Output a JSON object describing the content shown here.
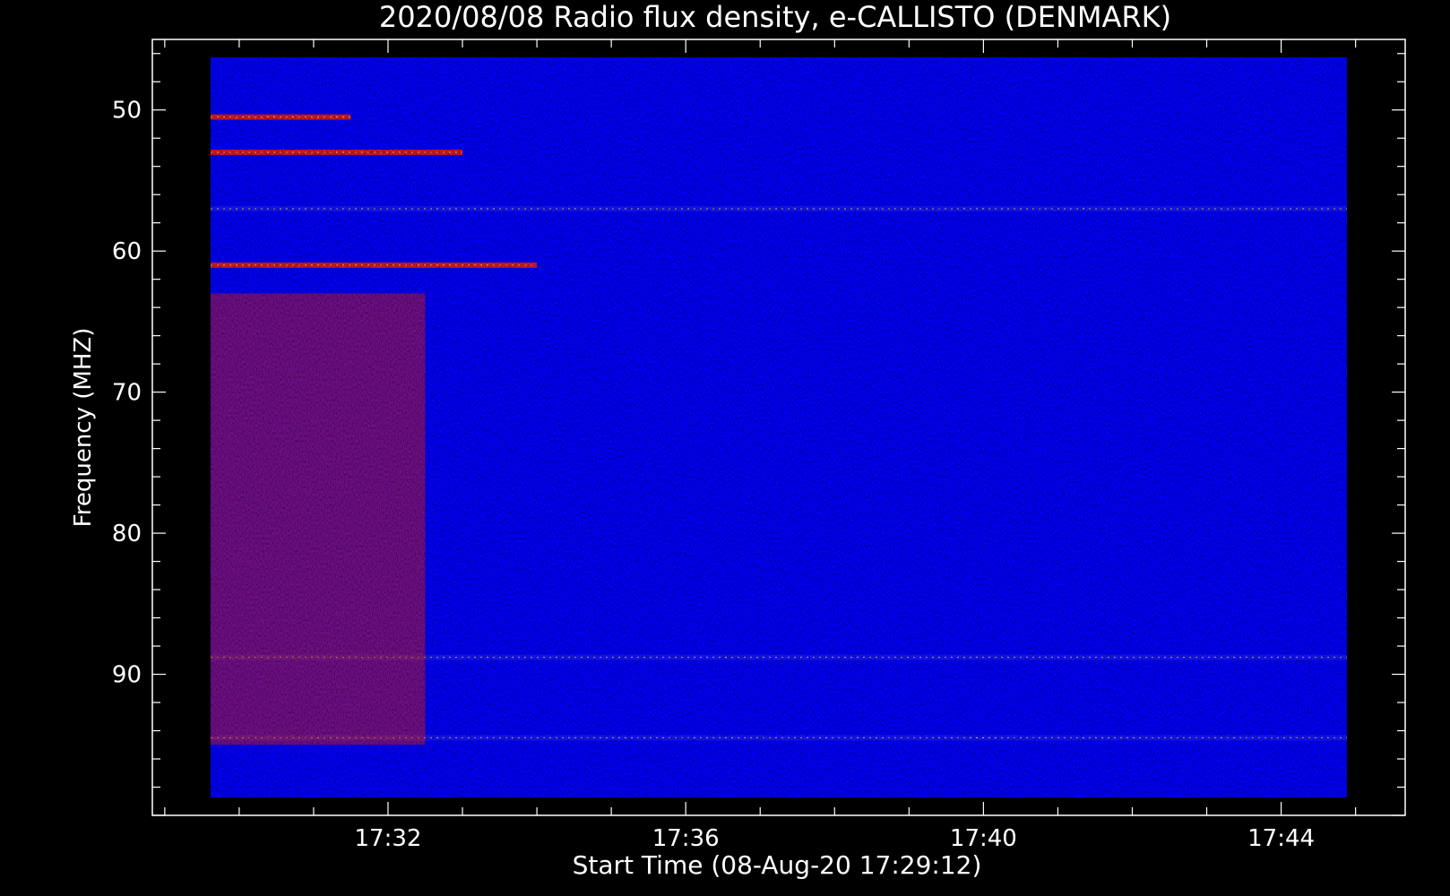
{
  "chart_data": {
    "type": "heatmap",
    "title": "2020/08/08  Radio flux density, e-CALLISTO (DENMARK)",
    "xlabel": "Start Time (08-Aug-20 17:29:12)",
    "ylabel": "Frequency (MHZ)",
    "x_range": [
      "17:28:50",
      "17:45:40"
    ],
    "xlim": [
      "17:28:50",
      "17:45:40"
    ],
    "ylim": [
      45,
      100
    ],
    "y_inverted": true,
    "x_ticks": [
      {
        "label": "17:32",
        "time": "17:32"
      },
      {
        "label": "17:36",
        "time": "17:36"
      },
      {
        "label": "17:40",
        "time": "17:40"
      },
      {
        "label": "17:44",
        "time": "17:44"
      }
    ],
    "y_ticks": [
      {
        "label": "50",
        "value": 50
      },
      {
        "label": "60",
        "value": 60
      },
      {
        "label": "70",
        "value": 70
      },
      {
        "label": "80",
        "value": 80
      },
      {
        "label": "90",
        "value": 90
      }
    ],
    "colormap": [
      "#000000",
      "#2020ff",
      "#ff2000",
      "#ffe060"
    ],
    "background_color": "#0000ff",
    "axes_color": "#ffffff",
    "features": [
      {
        "kind": "band",
        "freq": 50.5,
        "t_start": "17:29:12",
        "t_end": "17:31:30",
        "intensity": "high"
      },
      {
        "kind": "band",
        "freq": 53,
        "t_start": "17:29:12",
        "t_end": "17:33:00",
        "intensity": "high"
      },
      {
        "kind": "band",
        "freq": 57,
        "t_start": "17:29:12",
        "t_end": "17:45:30",
        "intensity": "medium"
      },
      {
        "kind": "band",
        "freq": 61,
        "t_start": "17:29:12",
        "t_end": "17:34:00",
        "intensity": "high"
      },
      {
        "kind": "band",
        "freq": 88.8,
        "t_start": "17:29:12",
        "t_end": "17:45:30",
        "intensity": "medium"
      },
      {
        "kind": "band",
        "freq": 94.5,
        "t_start": "17:29:12",
        "t_end": "17:45:30",
        "intensity": "medium"
      },
      {
        "kind": "region",
        "freq_range": [
          63,
          95
        ],
        "t_start": "17:29:12",
        "t_end": "17:32:30",
        "intensity": "high"
      }
    ]
  }
}
